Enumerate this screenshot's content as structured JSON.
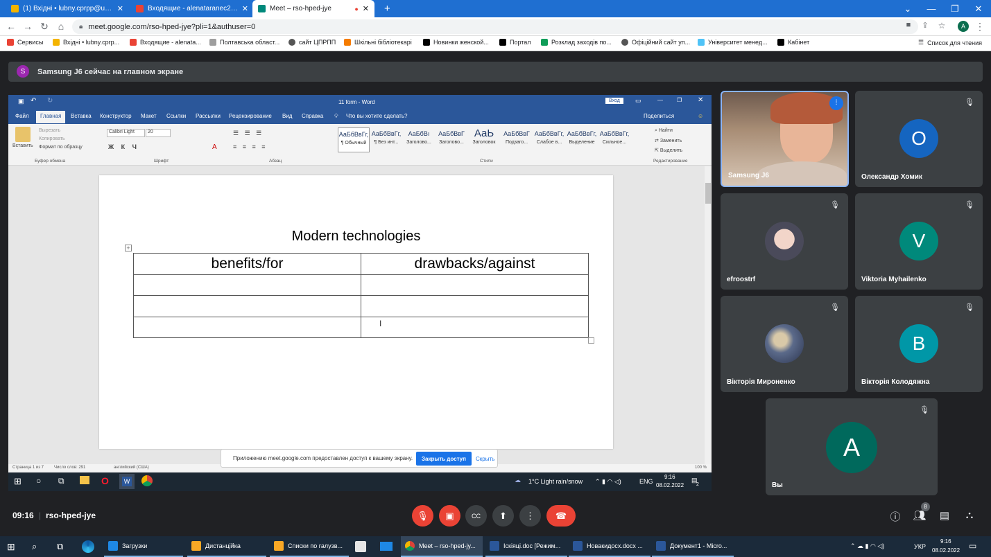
{
  "browser": {
    "tabs": [
      {
        "label": "(1) Вхідні • lubny.cprpp@ukr.net",
        "color": "#f4b400"
      },
      {
        "label": "Входящие - alenataranec2019@",
        "color": "#ea4335"
      },
      {
        "label": "Meet – rso-hped-jye",
        "color": "#00897b"
      }
    ],
    "new_tab": "+",
    "url": "meet.google.com/rso-hped-jye?pli=1&authuser=0",
    "profile_initial": "A",
    "bookmarks": [
      {
        "label": "Сервисы",
        "color": "#ea4335"
      },
      {
        "label": "Вхідні • lubny.cprp...",
        "color": "#f4b400"
      },
      {
        "label": "Входящие - alenata...",
        "color": "#ea4335"
      },
      {
        "label": "Полтавська област...",
        "color": "#9e9e9e"
      },
      {
        "label": "сайт ЦПРПП",
        "color": "#555555"
      },
      {
        "label": "Шкільні бібліотекарі",
        "color": "#f57c00"
      },
      {
        "label": "Новинки женской...",
        "color": "#000000"
      },
      {
        "label": "Портал",
        "color": "#000000"
      },
      {
        "label": "Розклад заходів по...",
        "color": "#0f9d58"
      },
      {
        "label": "Офіційний сайт уп...",
        "color": "#555555"
      },
      {
        "label": "Університет менед...",
        "color": "#4fc3f7"
      },
      {
        "label": "Кабінет",
        "color": "#000000"
      }
    ],
    "reading_list": "Список для чтения"
  },
  "meet": {
    "banner_initial": "S",
    "banner_text": "Samsung J6 сейчас на главном экране",
    "time": "09:16",
    "meeting_code": "rso-hped-jye",
    "participants_count": "8",
    "share_notice": "Приложению meet.google.com предоставлен доступ к вашему экрану.",
    "stop_sharing": "Закрыть доступ",
    "hide": "Скрыть",
    "tiles": [
      {
        "name": "Samsung J6",
        "type": "video"
      },
      {
        "name": "Олександр Хомик",
        "initial": "O",
        "color": "#1565c0"
      },
      {
        "name": "efroostrf",
        "type": "avatar-image"
      },
      {
        "name": "Viktoria Myhailenko",
        "initial": "V",
        "color": "#00897b"
      },
      {
        "name": "Вікторія Мироненко",
        "type": "avatar-image"
      },
      {
        "name": "Вікторія Колодяжна",
        "initial": "B",
        "color": "#0097a7"
      },
      {
        "name": "Вы",
        "initial": "A",
        "color": "#00695c"
      }
    ]
  },
  "word": {
    "title": "11 form  -  Word",
    "login": "Вход",
    "menu": [
      "Файл",
      "Главная",
      "Вставка",
      "Конструктор",
      "Макет",
      "Ссылки",
      "Рассылки",
      "Рецензирование",
      "Вид",
      "Справка"
    ],
    "tell_me": "Что вы хотите сделать?",
    "share": "Поделиться",
    "clipboard": {
      "paste": "Вставить",
      "cut": "Вырезать",
      "copy": "Копировать",
      "format": "Формат по образцу",
      "label": "Буфер обмена"
    },
    "font": {
      "name": "Calibri Light",
      "size": "20",
      "label": "Шрифт"
    },
    "paragraph_label": "Абзац",
    "styles_label": "Стили",
    "styles": [
      {
        "preview": "АаБбВвГг,",
        "name": "¶ Обычный"
      },
      {
        "preview": "АаБбВвГг,",
        "name": "¶ Без инт..."
      },
      {
        "preview": "АаБбВı",
        "name": "Заголово..."
      },
      {
        "preview": "АаБбВвГ",
        "name": "Заголово..."
      },
      {
        "preview": "АаЬ",
        "name": "Заголовок"
      },
      {
        "preview": "АаБбВвГ",
        "name": "Подзаго..."
      },
      {
        "preview": "АаБбВвГг,",
        "name": "Слабое в..."
      },
      {
        "preview": "АаБбВвГг,",
        "name": "Выделение"
      },
      {
        "preview": "АаБбВвГг,",
        "name": "Сильное..."
      }
    ],
    "editing": {
      "find": "Найти",
      "replace": "Заменить",
      "select": "Выделить",
      "label": "Редактирование"
    },
    "doc_title": "Modern technologies",
    "table": {
      "headers": [
        "benefits/for",
        "drawbacks/against"
      ],
      "rows": [
        [
          "",
          ""
        ],
        [
          "",
          ""
        ],
        [
          "",
          ""
        ]
      ]
    },
    "status": {
      "page": "Страница 1 из 7",
      "words": "Число слов: 291",
      "lang": "английский (США)",
      "zoom": "100 %"
    }
  },
  "remote_taskbar": {
    "weather": "1°C  Light rain/snow",
    "lang": "ENG",
    "time": "9:16",
    "date": "08.02.2022",
    "notif": "2"
  },
  "windows_taskbar": {
    "items": [
      {
        "label": "Загрузки",
        "color": "#1e88e5"
      },
      {
        "label": "Дистанційка",
        "color": "#f9a825"
      },
      {
        "label": "Списки по галузв...",
        "color": "#f9a825"
      },
      {
        "label": "Meet – rso-hped-jy...",
        "color": "#db4437"
      },
      {
        "label": "Іскіяці.doc [Режим...",
        "color": "#2b579a"
      },
      {
        "label": "Новакидосх.docx ...",
        "color": "#2b579a"
      },
      {
        "label": "Документ1 - Micro...",
        "color": "#2b579a"
      }
    ],
    "lang": "УКР",
    "time": "9:16",
    "date": "08.02.2022"
  }
}
